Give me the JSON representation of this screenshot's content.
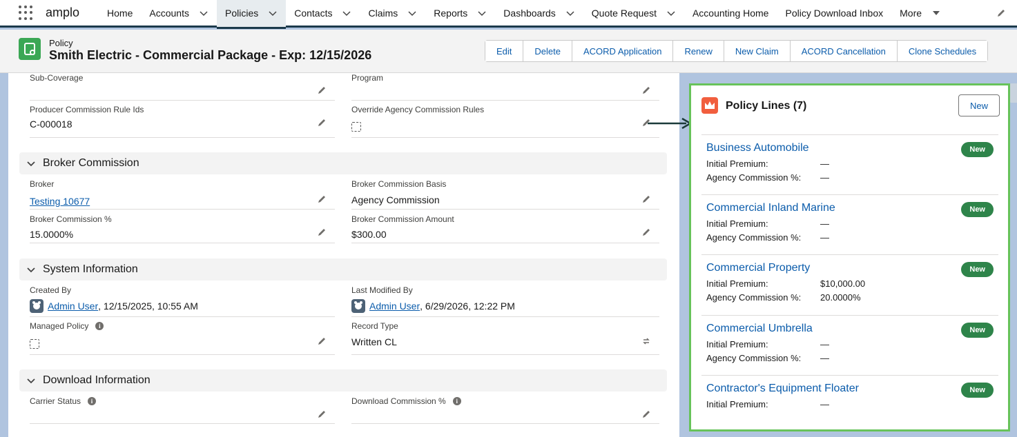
{
  "app": {
    "name": "amplo"
  },
  "nav": {
    "items": [
      {
        "label": "Home"
      },
      {
        "label": "Accounts"
      },
      {
        "label": "Policies"
      },
      {
        "label": "Contacts"
      },
      {
        "label": "Claims"
      },
      {
        "label": "Reports"
      },
      {
        "label": "Dashboards"
      },
      {
        "label": "Quote Request"
      },
      {
        "label": "Accounting Home"
      },
      {
        "label": "Policy Download Inbox"
      },
      {
        "label": "More"
      }
    ]
  },
  "header": {
    "type": "Policy",
    "title": "Smith Electric - Commercial Package - Exp: 12/15/2026",
    "buttons": [
      "Edit",
      "Delete",
      "ACORD Application",
      "Renew",
      "New Claim",
      "ACORD Cancellation",
      "Clone Schedules"
    ]
  },
  "fields": {
    "sub_coverage": {
      "label": "Sub-Coverage",
      "value": ""
    },
    "program": {
      "label": "Program",
      "value": ""
    },
    "producer_commission": {
      "label": "Producer Commission Rule Ids",
      "value": "C-000018"
    },
    "override_agency": {
      "label": "Override Agency Commission Rules"
    }
  },
  "broker_section": {
    "title": "Broker Commission",
    "broker": {
      "label": "Broker",
      "value": "Testing 10677"
    },
    "basis": {
      "label": "Broker Commission Basis",
      "value": "Agency Commission"
    },
    "pct": {
      "label": "Broker Commission %",
      "value": "15.0000%"
    },
    "amount": {
      "label": "Broker Commission Amount",
      "value": "$300.00"
    }
  },
  "system_section": {
    "title": "System Information",
    "created_by": {
      "label": "Created By",
      "user": "Admin User",
      "date": ", 12/15/2025, 10:55 AM"
    },
    "modified_by": {
      "label": "Last Modified By",
      "user": "Admin User",
      "date": ", 6/29/2026, 12:22 PM"
    },
    "managed": {
      "label": "Managed Policy"
    },
    "record_type": {
      "label": "Record Type",
      "value": "Written CL"
    }
  },
  "download_section": {
    "title": "Download Information",
    "carrier_status": {
      "label": "Carrier Status",
      "value": ""
    },
    "download_commission": {
      "label": "Download Commission %",
      "value": ""
    }
  },
  "policy_lines": {
    "title": "Policy Lines (7)",
    "new_label": "New",
    "premium_label": "Initial Premium:",
    "commission_label": "Agency Commission %:",
    "items": [
      {
        "name": "Business Automobile",
        "badge": "New",
        "premium": "—",
        "commission": "—"
      },
      {
        "name": "Commercial Inland Marine",
        "badge": "New",
        "premium": "—",
        "commission": "—"
      },
      {
        "name": "Commercial Property",
        "badge": "New",
        "premium": "$10,000.00",
        "commission": "20.0000%"
      },
      {
        "name": "Commercial Umbrella",
        "badge": "New",
        "premium": "—",
        "commission": "—"
      },
      {
        "name": "Contractor's Equipment Floater",
        "badge": "New",
        "premium": "—"
      }
    ]
  }
}
